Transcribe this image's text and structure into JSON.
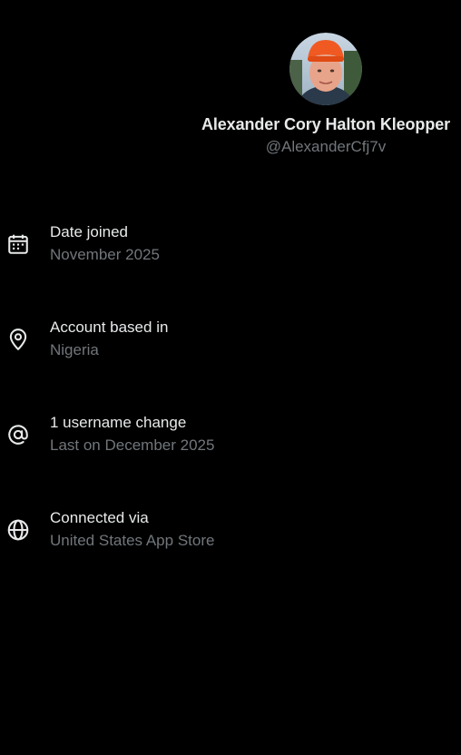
{
  "profile": {
    "display_name": "Alexander Cory Halton Kleopper",
    "handle": "@AlexanderCfj7v"
  },
  "info": {
    "items": [
      {
        "icon": "calendar-icon",
        "title": "Date joined",
        "subtitle": "November 2025"
      },
      {
        "icon": "location-pin-icon",
        "title": "Account based in",
        "subtitle": "Nigeria"
      },
      {
        "icon": "at-sign-icon",
        "title": "1 username change",
        "subtitle": "Last on December 2025"
      },
      {
        "icon": "globe-icon",
        "title": "Connected via",
        "subtitle": "United States App Store"
      }
    ]
  },
  "colors": {
    "background": "#000000",
    "primary_text": "#e7e9ea",
    "secondary_text": "#71767b"
  }
}
